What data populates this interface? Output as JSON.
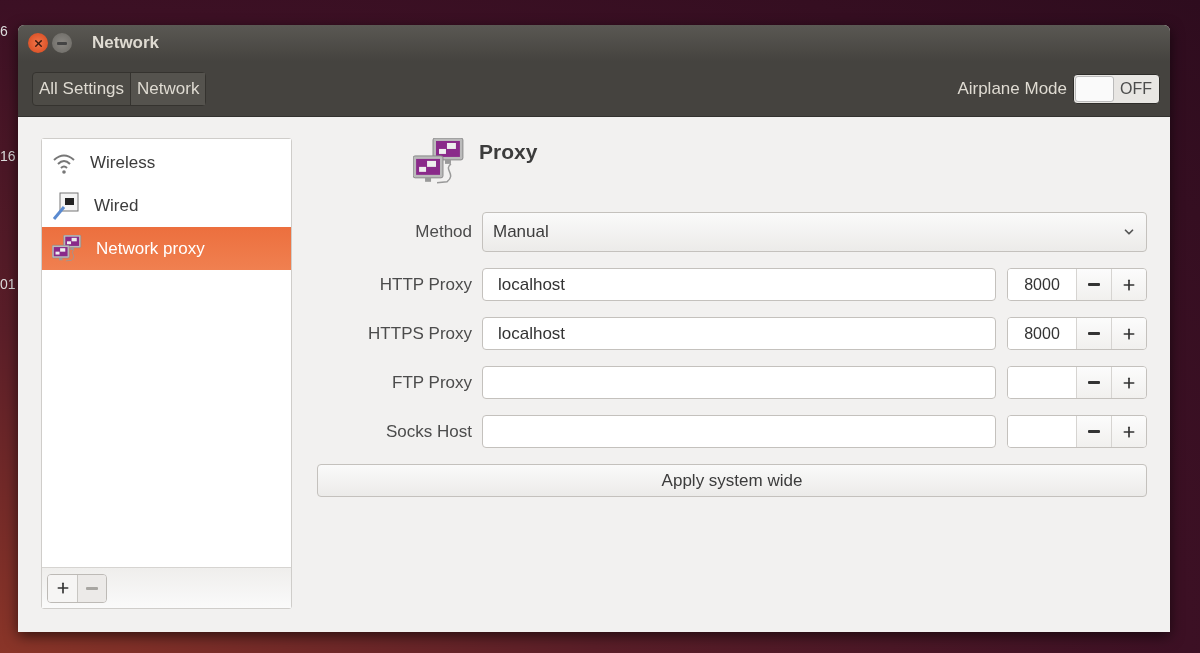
{
  "desktop_text": [
    "6",
    "16",
    "01"
  ],
  "window": {
    "title": "Network",
    "buttons": [
      {
        "kind": "close"
      },
      {
        "kind": "minimize"
      }
    ]
  },
  "toolbar": {
    "breadcrumbs": [
      {
        "label": "All Settings",
        "selected": false
      },
      {
        "label": "Network",
        "selected": true
      }
    ],
    "airplane_mode": {
      "label": "Airplane Mode",
      "on": false,
      "state_text": "OFF"
    }
  },
  "sidebar": {
    "items": [
      {
        "label": "Wireless",
        "kind": "wireless",
        "selected": false
      },
      {
        "label": "Wired",
        "kind": "wired",
        "selected": false
      },
      {
        "label": "Network proxy",
        "kind": "proxy",
        "selected": true
      }
    ],
    "footer_buttons": [
      {
        "kind": "add",
        "disabled": false
      },
      {
        "kind": "remove",
        "disabled": true
      }
    ]
  },
  "panel": {
    "title": "Proxy",
    "method": {
      "label": "Method",
      "value": "Manual"
    },
    "proxies": [
      {
        "label": "HTTP Proxy",
        "host": "localhost",
        "port": "8000"
      },
      {
        "label": "HTTPS Proxy",
        "host": "localhost",
        "port": "8000"
      },
      {
        "label": "FTP Proxy"
      },
      {
        "label": "Socks Host"
      }
    ],
    "apply_button": "Apply system wide"
  }
}
